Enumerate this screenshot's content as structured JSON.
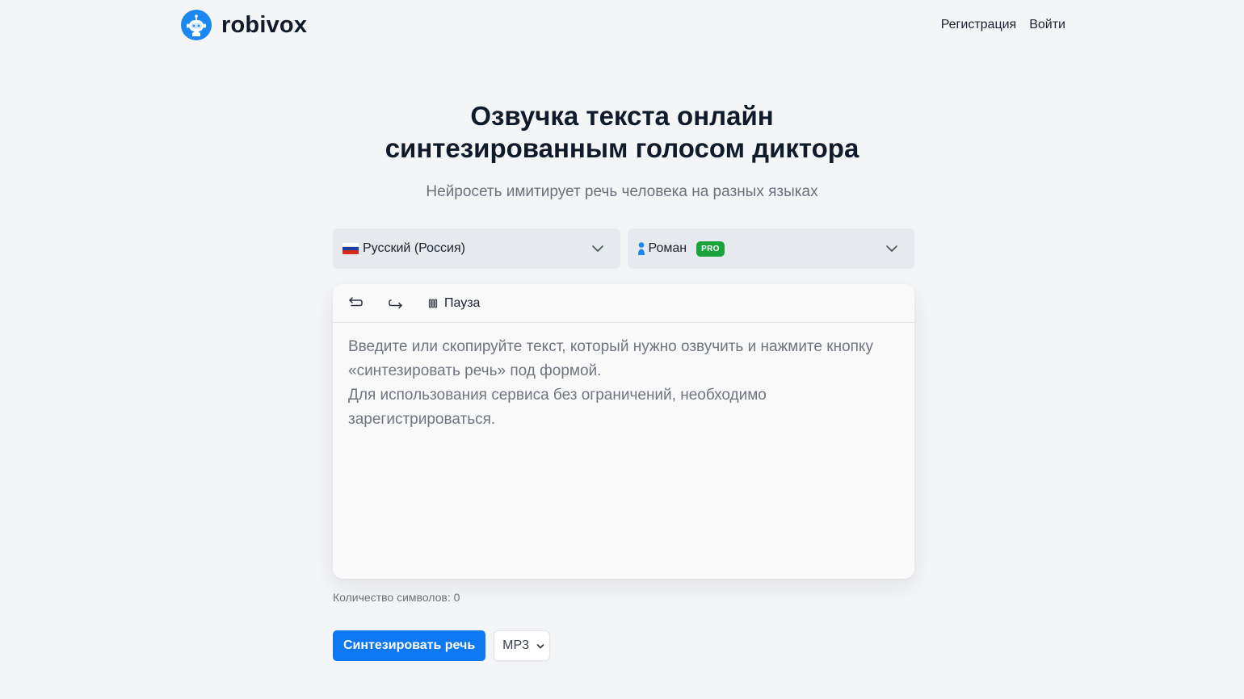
{
  "header": {
    "brand": "robivox",
    "nav": {
      "register": "Регистрация",
      "login": "Войти"
    }
  },
  "hero": {
    "title_line1": "Озвучка текста онлайн",
    "title_line2": "синтезированным голосом диктора",
    "subtitle": "Нейросеть имитирует речь человека на разных языках"
  },
  "selectors": {
    "language": {
      "value": "Русский (Россия)",
      "flag_icon": "russia-flag-icon"
    },
    "voice": {
      "value": "Роман",
      "badge": "PRO",
      "icon": "person-icon"
    }
  },
  "editor": {
    "toolbar": {
      "undo_icon": "undo-icon",
      "redo_icon": "redo-icon",
      "pause_label": "Пауза"
    },
    "placeholder": "Введите или скопируйте текст, который нужно озвучить и нажмите кнопку «синтезировать речь» под формой.\nДля использования сервиса без ограничений, необходимо зарегистрироваться.",
    "value": ""
  },
  "char_count": "Количество символов: 0",
  "actions": {
    "synthesize_label": "Синтезировать речь",
    "format_value": "MP3"
  },
  "colors": {
    "accent": "#0d78f2",
    "pro_badge": "#19a33a",
    "background": "#f4f5f7",
    "select_bg": "#e6e9ee"
  }
}
